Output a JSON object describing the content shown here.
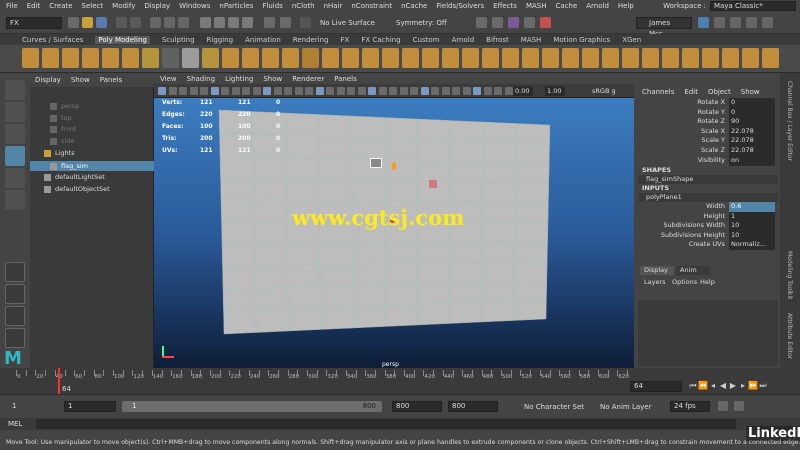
{
  "menubar": {
    "items": [
      "File",
      "Edit",
      "Create",
      "Select",
      "Modify",
      "Display",
      "Windows",
      "nParticles",
      "Fluids",
      "nCloth",
      "nHair",
      "nConstraint",
      "nCache",
      "Fields/Solvers",
      "Effects",
      "MASH",
      "Cache",
      "Arnold",
      "Help"
    ],
    "workspace_label": "Workspace :",
    "workspace_value": "Maya Classic*"
  },
  "statusline": {
    "menu_set": "FX",
    "live_surface": "No Live Surface",
    "symmetry": "Symmetry: Off",
    "user": "James Mcc..."
  },
  "shelf": {
    "tabs": [
      "Curves / Surfaces",
      "Poly Modeling",
      "Sculpting",
      "Rigging",
      "Animation",
      "Rendering",
      "FX",
      "FX Caching",
      "Custom",
      "Arnold",
      "Bifrost",
      "MASH",
      "Motion Graphics",
      "XGen"
    ],
    "active_tab": "Poly Modeling"
  },
  "outliner": {
    "menu": [
      "Display",
      "Show",
      "Panels"
    ],
    "items": [
      "persp",
      "top",
      "front",
      "side",
      "Lights",
      "flag_sim",
      "defaultLightSet",
      "defaultObjectSet"
    ],
    "selected": "flag_sim"
  },
  "viewport": {
    "menu": [
      "View",
      "Shading",
      "Lighting",
      "Show",
      "Renderer",
      "Panels"
    ],
    "value1": "0.00",
    "value2": "1.00",
    "color_space": "sRGB g",
    "camera": "persp",
    "watermark": "www.cgtsj.com",
    "hud": [
      {
        "label": "Verts:",
        "v1": "121",
        "v2": "121",
        "v3": "0"
      },
      {
        "label": "Edges:",
        "v1": "220",
        "v2": "220",
        "v3": "0"
      },
      {
        "label": "Faces:",
        "v1": "100",
        "v2": "100",
        "v3": "0"
      },
      {
        "label": "Tris:",
        "v1": "200",
        "v2": "200",
        "v3": "0"
      },
      {
        "label": "UVs:",
        "v1": "121",
        "v2": "121",
        "v3": "0"
      }
    ]
  },
  "channelbox": {
    "menu": [
      "Channels",
      "Edit",
      "Object",
      "Show"
    ],
    "transform": [
      {
        "label": "Rotate X",
        "value": "0"
      },
      {
        "label": "Rotate Y",
        "value": "0"
      },
      {
        "label": "Rotate Z",
        "value": "90"
      },
      {
        "label": "Scale X",
        "value": "22.078"
      },
      {
        "label": "Scale Y",
        "value": "22.078"
      },
      {
        "label": "Scale Z",
        "value": "22.078"
      },
      {
        "label": "Visibility",
        "value": "on"
      }
    ],
    "shapes_header": "SHAPES",
    "shape_name": "flag_simShape",
    "inputs_header": "INPUTS",
    "input_name": "polyPlane1",
    "inputs": [
      {
        "label": "Width",
        "value": "0.6"
      },
      {
        "label": "Height",
        "value": "1"
      },
      {
        "label": "Subdivisions Width",
        "value": "10"
      },
      {
        "label": "Subdivisions Height",
        "value": "10"
      },
      {
        "label": "Create UVs",
        "value": "Normaliz..."
      }
    ],
    "layer_tabs": [
      "Display",
      "Anim"
    ],
    "layer_menu": [
      "Layers",
      "Options",
      "Help"
    ]
  },
  "sidetabs": {
    "channel_box": "Channel Box / Layer Editor",
    "modeling_toolkit": "Modeling Toolkit",
    "attribute_editor": "Attribute Editor"
  },
  "timeline": {
    "ticks": [
      "0",
      "10",
      "20",
      "30",
      "40",
      "50",
      "60",
      "70",
      "80",
      "90",
      "100",
      "110",
      "120",
      "130",
      "140",
      "150",
      "160",
      "170",
      "180",
      "190",
      "200",
      "210",
      "220",
      "230",
      "240",
      "250",
      "260",
      "270",
      "280",
      "290",
      "300",
      "310",
      "320",
      "330",
      "340",
      "350",
      "360",
      "370",
      "380",
      "390",
      "400",
      "410",
      "420",
      "430",
      "440",
      "450",
      "460",
      "470",
      "480",
      "490",
      "500",
      "510",
      "520",
      "530",
      "540",
      "550",
      "560",
      "570",
      "580",
      "590",
      "600",
      "610",
      "620",
      "630"
    ],
    "current_frame_left": "64",
    "current_frame_right": "64"
  },
  "range": {
    "start": "1",
    "start2": "1",
    "slider_label": "1",
    "slider_end": "800",
    "end": "800",
    "end2": "800",
    "char_set": "No Character Set",
    "anim_layer": "No Anim Layer",
    "fps": "24 fps"
  },
  "cmd": {
    "label": "MEL"
  },
  "help": {
    "text": "Move Tool: Use manipulator to move object(s). Ctrl+MMB+drag to move components along normals. Shift+drag manipulator axis or plane handles to extrude components or clone objects. Ctrl+Shift+LMB+drag to constrain movement to a connected edge. Use D or HOME to"
  },
  "brand": "LinkedIn",
  "colors": {
    "accent": "#5285a6",
    "viewport_top": "#3f83c6",
    "selected": "#5285a6",
    "maya_logo": "#2fb8c4"
  }
}
